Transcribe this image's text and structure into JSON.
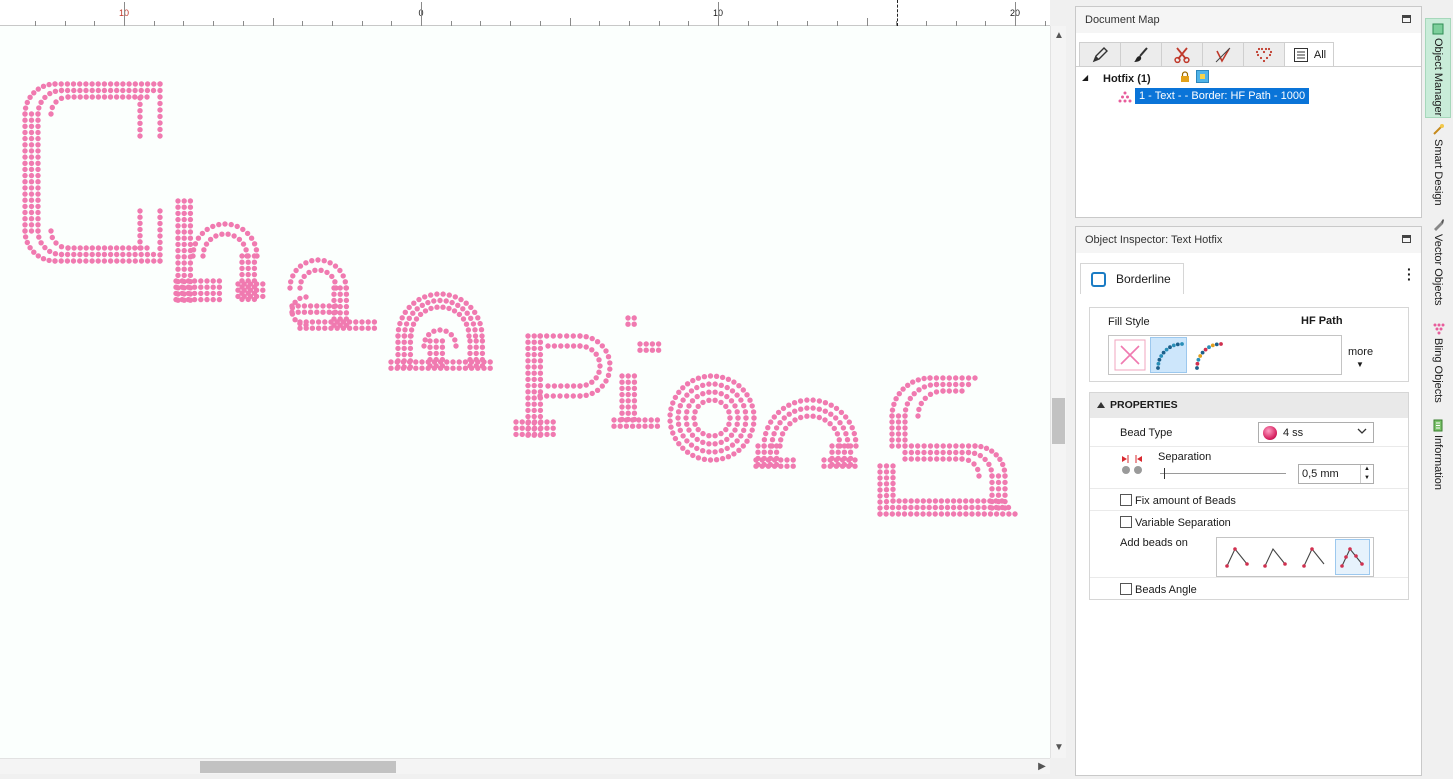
{
  "ruler": {
    "labels": [
      "10",
      "0",
      "10",
      "20"
    ],
    "colors": {
      "negative": "#c0392b",
      "positive": "#222222"
    }
  },
  "canvas": {
    "design_text": "Champions",
    "bead_color": "#f07ab0",
    "background": "#fbfffd"
  },
  "document_map": {
    "title": "Document Map",
    "tabs": [
      {
        "icon": "pencil-icon"
      },
      {
        "icon": "brush-icon"
      },
      {
        "icon": "scissors-icon"
      },
      {
        "icon": "needle-icon"
      },
      {
        "icon": "heart-beads-icon"
      },
      {
        "icon": "list-icon",
        "label": "All"
      }
    ],
    "tree": {
      "group_label": "Hotfix (1)",
      "item_label": "1 - Text -  - Border: HF Path - 1000"
    }
  },
  "inspector": {
    "title": "Object Inspector: Text Hotfix",
    "tab_label": "Borderline",
    "fill_style_label": "Fill Style",
    "fill_style_value": "HF Path",
    "more_label": "more",
    "properties_header": "PROPERTIES",
    "bead_type_label": "Bead Type",
    "bead_type_value": "4 ss",
    "separation_label": "Separation",
    "separation_value": "0,5 mm",
    "fix_amount_label": "Fix amount of Beads",
    "variable_sep_label": "Variable Separation",
    "add_beads_label": "Add beads on",
    "beads_angle_label": "Beads Angle"
  },
  "side_tabs": [
    {
      "label": "Object Manager",
      "icon": "object-manager-icon",
      "active": true
    },
    {
      "label": "Smart Design",
      "icon": "smart-design-icon",
      "active": false
    },
    {
      "label": "Vector Objects",
      "icon": "vector-objects-icon",
      "active": false
    },
    {
      "label": "Bling Objects",
      "icon": "bling-objects-icon",
      "active": false
    },
    {
      "label": "Information",
      "icon": "information-icon",
      "active": false
    }
  ]
}
